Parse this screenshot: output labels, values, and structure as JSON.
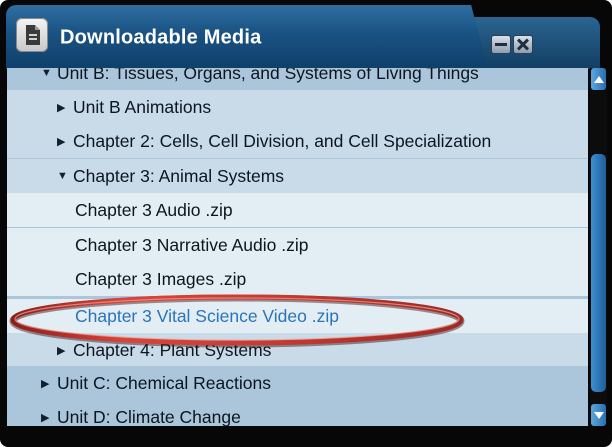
{
  "window": {
    "title": "Downloadable Media",
    "icon": "document-icon",
    "controls": [
      "minimize-icon",
      "close-icon"
    ]
  },
  "colors": {
    "title_bar": "#1a5384",
    "tree_bg_level0": "#abc5da",
    "tree_bg_level1": "#c9dbe8",
    "tree_bg_level2": "#e3edf4",
    "highlight_text": "#2a74b8",
    "highlight_oval": "#c9342c",
    "scrollbar": "#2a6fb0"
  },
  "tree": {
    "items": [
      {
        "label": "Unit B: Tissues, Organs, and Systems of Living Things",
        "level": 0,
        "expanded": true
      },
      {
        "label": "Unit B Animations",
        "level": 1,
        "expanded": false
      },
      {
        "label": "Chapter 2: Cells, Cell Division, and Cell Specialization",
        "level": 1,
        "expanded": false
      },
      {
        "label": "Chapter 3: Animal Systems",
        "level": 1,
        "expanded": true
      },
      {
        "label": "Chapter 3 Audio .zip",
        "level": 2
      },
      {
        "label": "Chapter 3 Narrative Audio .zip",
        "level": 2
      },
      {
        "label": "Chapter 3 Images .zip",
        "level": 2
      },
      {
        "label": "Chapter 3 Vital Science Video .zip",
        "level": 2,
        "highlighted": true
      },
      {
        "label": "Chapter 4: Plant Systems",
        "level": 1,
        "expanded": false
      },
      {
        "label": "Unit C: Chemical Reactions",
        "level": 0,
        "expanded": false
      },
      {
        "label": "Unit D: Climate Change",
        "level": 0,
        "expanded": false
      }
    ]
  }
}
